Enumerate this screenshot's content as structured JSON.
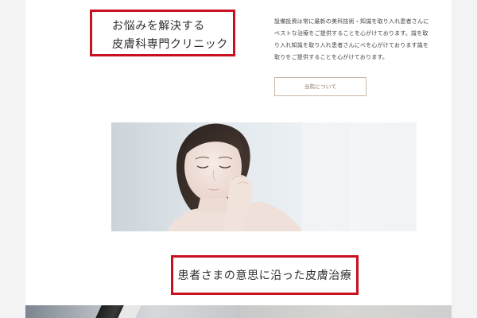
{
  "hero": {
    "heading_lines": [
      "お悩みを解決する",
      "皮膚科専門クリニック"
    ],
    "intro_lines": [
      "設備投資は常に最新の美科技術・知識を取り入れ患者さんに",
      "ベストな治療をご提供することを心がけております。識を取",
      "り入れ知識を取り入れ患者さんにべを心がけております識を",
      "取りをご提供することを心がけております。"
    ],
    "about_button_label": "当院について",
    "photo_icon": "woman-touching-face-photo"
  },
  "concept": {
    "heading": "患者さまの意思に沿った皮膚治療"
  },
  "colors": {
    "highlight_border": "#c8101e",
    "button_border": "#c9b6a6",
    "button_text": "#8c7262"
  }
}
